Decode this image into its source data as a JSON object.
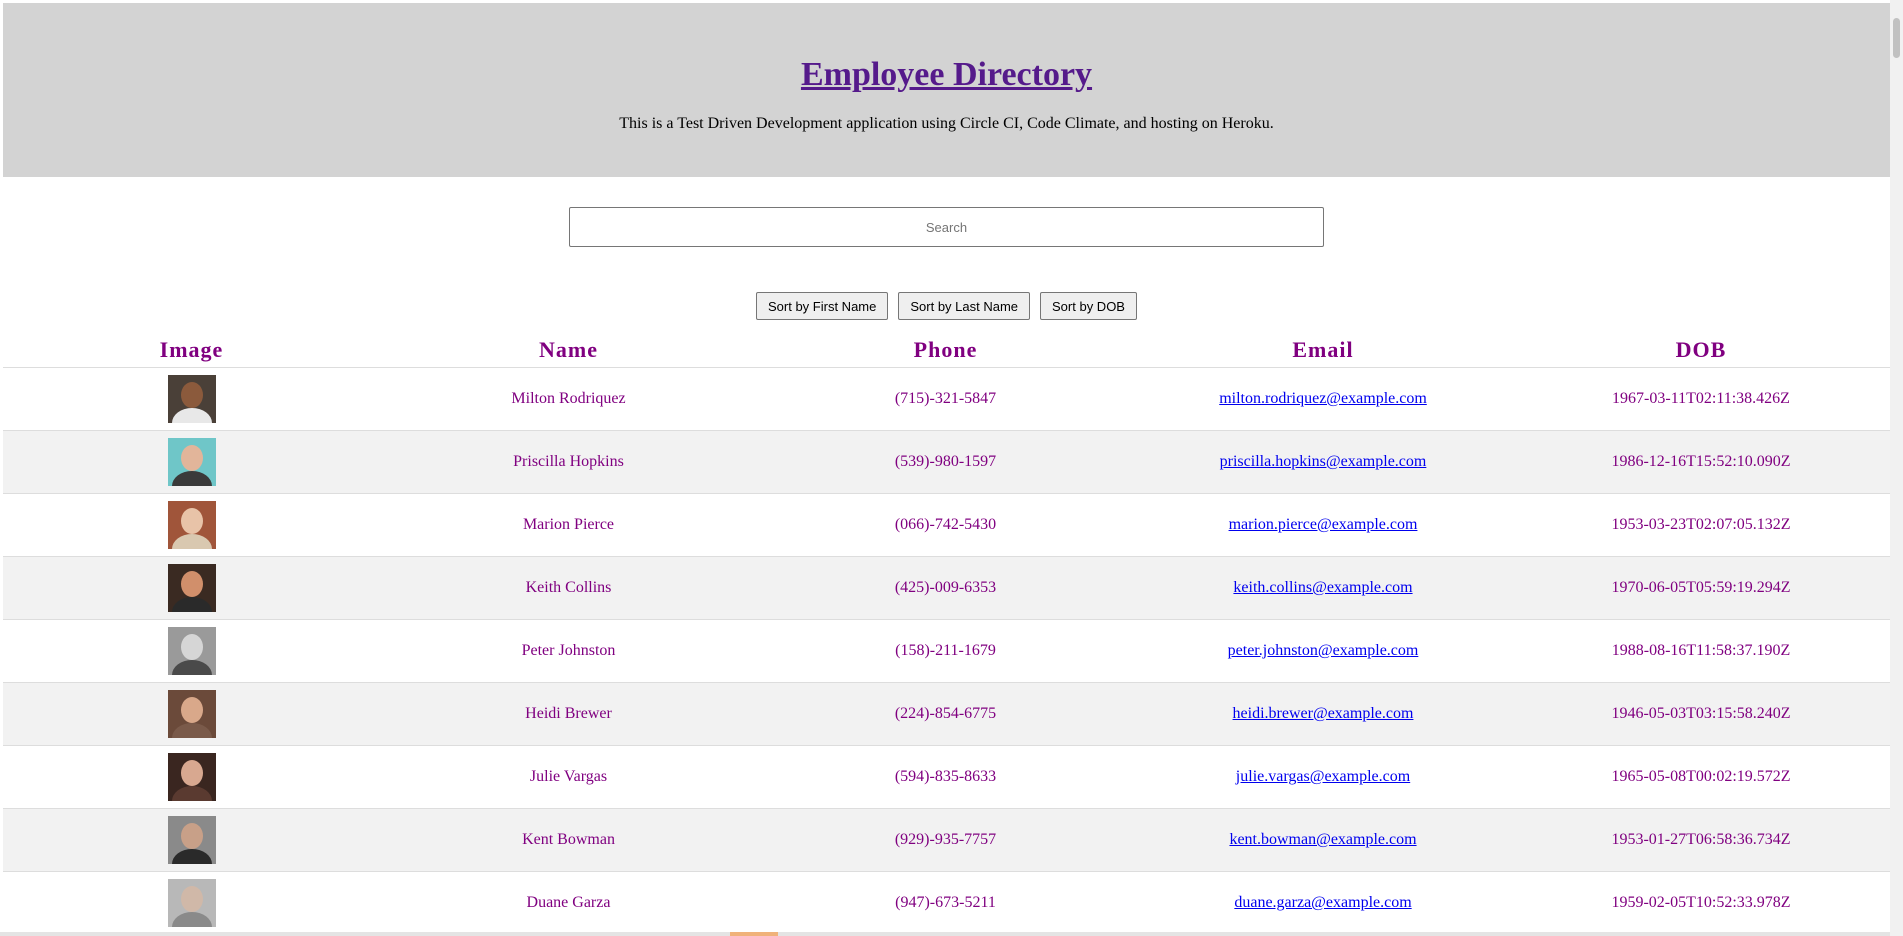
{
  "header": {
    "title": "Employee Directory",
    "subtitle": "This is a Test Driven Development application using Circle CI, Code Climate, and hosting on Heroku."
  },
  "search": {
    "placeholder": "Search",
    "value": ""
  },
  "sort_buttons": {
    "first_name": "Sort by First Name",
    "last_name": "Sort by Last Name",
    "dob": "Sort by DOB"
  },
  "table": {
    "columns": [
      "Image",
      "Name",
      "Phone",
      "Email",
      "DOB"
    ],
    "rows": [
      {
        "name": "Milton Rodriquez",
        "phone": "(715)-321-5847",
        "email": "milton.rodriquez@example.com",
        "dob": "1967-03-11T02:11:38.426Z",
        "avatar": {
          "bg": "#4a4038",
          "skin": "#8b5a3c",
          "shirt": "#e8e8e8"
        }
      },
      {
        "name": "Priscilla Hopkins",
        "phone": "(539)-980-1597",
        "email": "priscilla.hopkins@example.com",
        "dob": "1986-12-16T15:52:10.090Z",
        "avatar": {
          "bg": "#6fc6c8",
          "skin": "#e2b59a",
          "shirt": "#3a3a3a"
        }
      },
      {
        "name": "Marion Pierce",
        "phone": "(066)-742-5430",
        "email": "marion.pierce@example.com",
        "dob": "1953-03-23T02:07:05.132Z",
        "avatar": {
          "bg": "#a0553a",
          "skin": "#e8c3a8",
          "shirt": "#d9c8b0"
        }
      },
      {
        "name": "Keith Collins",
        "phone": "(425)-009-6353",
        "email": "keith.collins@example.com",
        "dob": "1970-06-05T05:59:19.294Z",
        "avatar": {
          "bg": "#3a2a22",
          "skin": "#d18f6b",
          "shirt": "#2a2a2a"
        }
      },
      {
        "name": "Peter Johnston",
        "phone": "(158)-211-1679",
        "email": "peter.johnston@example.com",
        "dob": "1988-08-16T11:58:37.190Z",
        "avatar": {
          "bg": "#9a9a9a",
          "skin": "#d6d6d6",
          "shirt": "#4a4a4a"
        }
      },
      {
        "name": "Heidi Brewer",
        "phone": "(224)-854-6775",
        "email": "heidi.brewer@example.com",
        "dob": "1946-05-03T03:15:58.240Z",
        "avatar": {
          "bg": "#6b4a3a",
          "skin": "#d9a88a",
          "shirt": "#7a5a4a"
        }
      },
      {
        "name": "Julie Vargas",
        "phone": "(594)-835-8633",
        "email": "julie.vargas@example.com",
        "dob": "1965-05-08T00:02:19.572Z",
        "avatar": {
          "bg": "#3a2620",
          "skin": "#d8a890",
          "shirt": "#5a3a30"
        }
      },
      {
        "name": "Kent Bowman",
        "phone": "(929)-935-7757",
        "email": "kent.bowman@example.com",
        "dob": "1953-01-27T06:58:36.734Z",
        "avatar": {
          "bg": "#8a8a8a",
          "skin": "#c8a088",
          "shirt": "#2a2a2a"
        }
      },
      {
        "name": "Duane Garza",
        "phone": "(947)-673-5211",
        "email": "duane.garza@example.com",
        "dob": "1959-02-05T10:52:33.978Z",
        "avatar": {
          "bg": "#b8b8b8",
          "skin": "#d0b8a8",
          "shirt": "#8a8a8a"
        }
      }
    ]
  }
}
